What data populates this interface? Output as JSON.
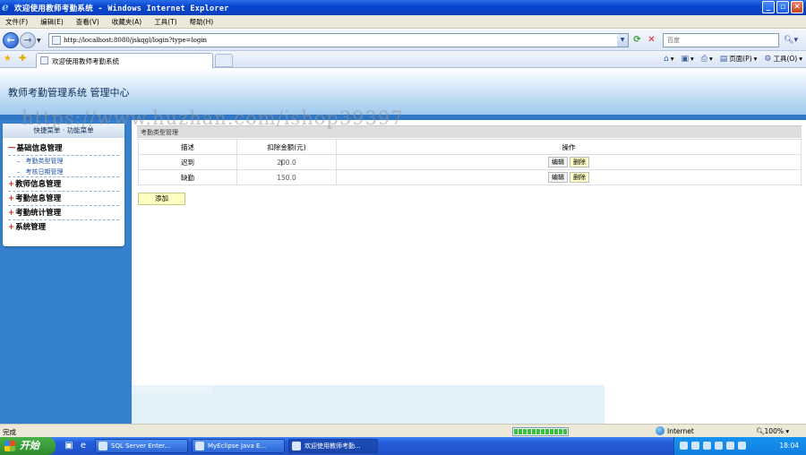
{
  "window": {
    "title": "欢迎使用教师考勤系统 - Windows Internet Explorer"
  },
  "menubar": {
    "items": [
      "文件(F)",
      "编辑(E)",
      "查看(V)",
      "收藏夹(A)",
      "工具(T)",
      "帮助(H)"
    ]
  },
  "address": {
    "url": "http://localhost:8080/jskqgl/login?type=login",
    "search_placeholder": "百度"
  },
  "tabs": {
    "active_label": "欢迎使用教师考勤系统"
  },
  "commandbar": {
    "page_label": "页面(P)",
    "tools_label": "工具(O)"
  },
  "app": {
    "title": "教师考勤管理系统 管理中心",
    "watermark": "https://www.huzhan.com/ishop39397"
  },
  "sidebar": {
    "header": "快捷菜单 · 功能菜单",
    "groups": [
      {
        "symbol": "一",
        "label": "基础信息管理",
        "items": [
          "考勤类型管理",
          "考核日期管理"
        ]
      },
      {
        "symbol": "+",
        "label": "教师信息管理"
      },
      {
        "symbol": "+",
        "label": "考勤信息管理"
      },
      {
        "symbol": "+",
        "label": "考勤统计管理"
      },
      {
        "symbol": "+",
        "label": "系统管理"
      }
    ]
  },
  "main": {
    "panel_title": "考勤类型管理",
    "columns": [
      "描述",
      "扣除金额(元)",
      "操作"
    ],
    "rows": [
      {
        "desc": "迟到",
        "amount": "200.0"
      },
      {
        "desc": "缺勤",
        "amount": "150.0"
      }
    ],
    "edit_label": "编辑",
    "delete_label": "删除",
    "add_label": "添加"
  },
  "statusbar": {
    "text": "完成",
    "progress": 1.0,
    "zone": "Internet",
    "zoom": "100%"
  },
  "taskbar": {
    "start_label": "开始",
    "tasks": [
      "SQL Server Enter...",
      "MyEclipse Java E...",
      "欢迎使用教师考勤..."
    ],
    "clock": "18:04"
  },
  "colors": {
    "titlebar": "#0a46cf",
    "sidebar": "#3581cf",
    "header_band": "#2f77c4",
    "delete_btn": "#ffffc6",
    "accent_red": "#cc2222"
  }
}
